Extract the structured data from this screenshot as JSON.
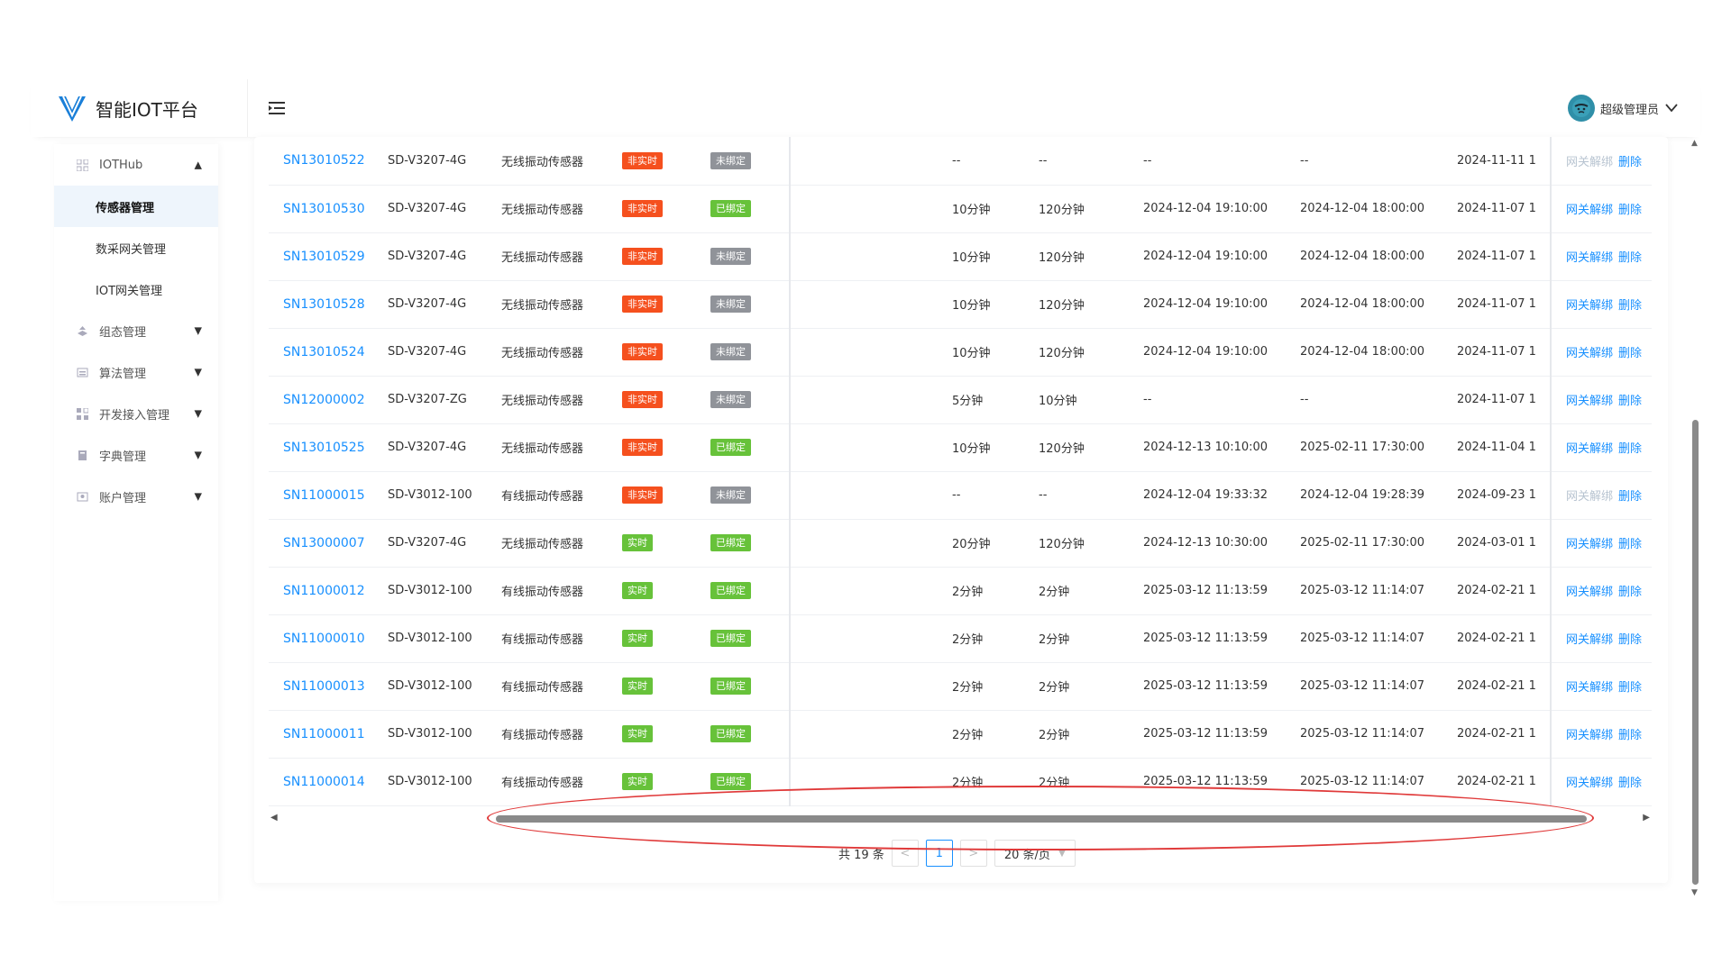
{
  "header": {
    "brand": "智能IOT平台",
    "user": "超级管理员"
  },
  "sidebar": {
    "groups": [
      {
        "label": "IOTHub",
        "icon": "grid-icon",
        "expanded": true,
        "children": [
          "传感器管理",
          "数采网关管理",
          "IOT网关管理"
        ],
        "active_child": 0
      },
      {
        "label": "组态管理",
        "icon": "layers-icon"
      },
      {
        "label": "算法管理",
        "icon": "list-icon"
      },
      {
        "label": "开发接入管理",
        "icon": "apps-icon"
      },
      {
        "label": "字典管理",
        "icon": "book-icon"
      },
      {
        "label": "账户管理",
        "icon": "user-card-icon"
      }
    ]
  },
  "table": {
    "rows": [
      {
        "sn": "SN13010522",
        "model": "SD-V3207-4G",
        "type": "无线振动传感器",
        "rt": "非实时",
        "bind": "未绑定",
        "p1": "--",
        "p2": "--",
        "t1": "--",
        "t2": "--",
        "created": "2024-11-11 1",
        "unbind": "网关解绑",
        "unbind_disabled": true,
        "del": "删除"
      },
      {
        "sn": "SN13010530",
        "model": "SD-V3207-4G",
        "type": "无线振动传感器",
        "rt": "非实时",
        "bind": "已绑定",
        "p1": "10分钟",
        "p2": "120分钟",
        "t1": "2024-12-04 19:10:00",
        "t2": "2024-12-04 18:00:00",
        "created": "2024-11-07 1",
        "unbind": "网关解绑",
        "unbind_disabled": false,
        "del": "删除"
      },
      {
        "sn": "SN13010529",
        "model": "SD-V3207-4G",
        "type": "无线振动传感器",
        "rt": "非实时",
        "bind": "未绑定",
        "p1": "10分钟",
        "p2": "120分钟",
        "t1": "2024-12-04 19:10:00",
        "t2": "2024-12-04 18:00:00",
        "created": "2024-11-07 1",
        "unbind": "网关解绑",
        "unbind_disabled": false,
        "del": "删除"
      },
      {
        "sn": "SN13010528",
        "model": "SD-V3207-4G",
        "type": "无线振动传感器",
        "rt": "非实时",
        "bind": "未绑定",
        "p1": "10分钟",
        "p2": "120分钟",
        "t1": "2024-12-04 19:10:00",
        "t2": "2024-12-04 18:00:00",
        "created": "2024-11-07 1",
        "unbind": "网关解绑",
        "unbind_disabled": false,
        "del": "删除"
      },
      {
        "sn": "SN13010524",
        "model": "SD-V3207-4G",
        "type": "无线振动传感器",
        "rt": "非实时",
        "bind": "未绑定",
        "p1": "10分钟",
        "p2": "120分钟",
        "t1": "2024-12-04 19:10:00",
        "t2": "2024-12-04 18:00:00",
        "created": "2024-11-07 1",
        "unbind": "网关解绑",
        "unbind_disabled": false,
        "del": "删除"
      },
      {
        "sn": "SN12000002",
        "model": "SD-V3207-ZG",
        "type": "无线振动传感器",
        "rt": "非实时",
        "bind": "未绑定",
        "p1": "5分钟",
        "p2": "10分钟",
        "t1": "--",
        "t2": "--",
        "created": "2024-11-07 1",
        "unbind": "网关解绑",
        "unbind_disabled": false,
        "del": "删除"
      },
      {
        "sn": "SN13010525",
        "model": "SD-V3207-4G",
        "type": "无线振动传感器",
        "rt": "非实时",
        "bind": "已绑定",
        "p1": "10分钟",
        "p2": "120分钟",
        "t1": "2024-12-13 10:10:00",
        "t2": "2025-02-11 17:30:00",
        "created": "2024-11-04 1",
        "unbind": "网关解绑",
        "unbind_disabled": false,
        "del": "删除"
      },
      {
        "sn": "SN11000015",
        "model": "SD-V3012-100",
        "type": "有线振动传感器",
        "rt": "非实时",
        "bind": "未绑定",
        "p1": "--",
        "p2": "--",
        "t1": "2024-12-04 19:33:32",
        "t2": "2024-12-04 19:28:39",
        "created": "2024-09-23 1",
        "unbind": "网关解绑",
        "unbind_disabled": true,
        "del": "删除"
      },
      {
        "sn": "SN13000007",
        "model": "SD-V3207-4G",
        "type": "无线振动传感器",
        "rt": "实时",
        "bind": "已绑定",
        "p1": "20分钟",
        "p2": "120分钟",
        "t1": "2024-12-13 10:30:00",
        "t2": "2025-02-11 17:30:00",
        "created": "2024-03-01 1",
        "unbind": "网关解绑",
        "unbind_disabled": false,
        "del": "删除"
      },
      {
        "sn": "SN11000012",
        "model": "SD-V3012-100",
        "type": "有线振动传感器",
        "rt": "实时",
        "bind": "已绑定",
        "p1": "2分钟",
        "p2": "2分钟",
        "t1": "2025-03-12 11:13:59",
        "t2": "2025-03-12 11:14:07",
        "created": "2024-02-21 1",
        "unbind": "网关解绑",
        "unbind_disabled": false,
        "del": "删除"
      },
      {
        "sn": "SN11000010",
        "model": "SD-V3012-100",
        "type": "有线振动传感器",
        "rt": "实时",
        "bind": "已绑定",
        "p1": "2分钟",
        "p2": "2分钟",
        "t1": "2025-03-12 11:13:59",
        "t2": "2025-03-12 11:14:07",
        "created": "2024-02-21 1",
        "unbind": "网关解绑",
        "unbind_disabled": false,
        "del": "删除"
      },
      {
        "sn": "SN11000013",
        "model": "SD-V3012-100",
        "type": "有线振动传感器",
        "rt": "实时",
        "bind": "已绑定",
        "p1": "2分钟",
        "p2": "2分钟",
        "t1": "2025-03-12 11:13:59",
        "t2": "2025-03-12 11:14:07",
        "created": "2024-02-21 1",
        "unbind": "网关解绑",
        "unbind_disabled": false,
        "del": "删除"
      },
      {
        "sn": "SN11000011",
        "model": "SD-V3012-100",
        "type": "有线振动传感器",
        "rt": "实时",
        "bind": "已绑定",
        "p1": "2分钟",
        "p2": "2分钟",
        "t1": "2025-03-12 11:13:59",
        "t2": "2025-03-12 11:14:07",
        "created": "2024-02-21 1",
        "unbind": "网关解绑",
        "unbind_disabled": false,
        "del": "删除"
      },
      {
        "sn": "SN11000014",
        "model": "SD-V3012-100",
        "type": "有线振动传感器",
        "rt": "实时",
        "bind": "已绑定",
        "p1": "2分钟",
        "p2": "2分钟",
        "t1": "2025-03-12 11:13:59",
        "t2": "2025-03-12 11:14:07",
        "created": "2024-02-21 1",
        "unbind": "网关解绑",
        "unbind_disabled": false,
        "del": "删除"
      }
    ]
  },
  "pagination": {
    "total": "共 19 条",
    "prev": "<",
    "current": "1",
    "next": ">",
    "page_size": "20 条/页"
  },
  "colors": {
    "accent": "#1890ff",
    "tag_red": "#f5501e",
    "tag_green": "#67c23a",
    "tag_gray": "#909399",
    "highlight": "#e03a3a"
  }
}
